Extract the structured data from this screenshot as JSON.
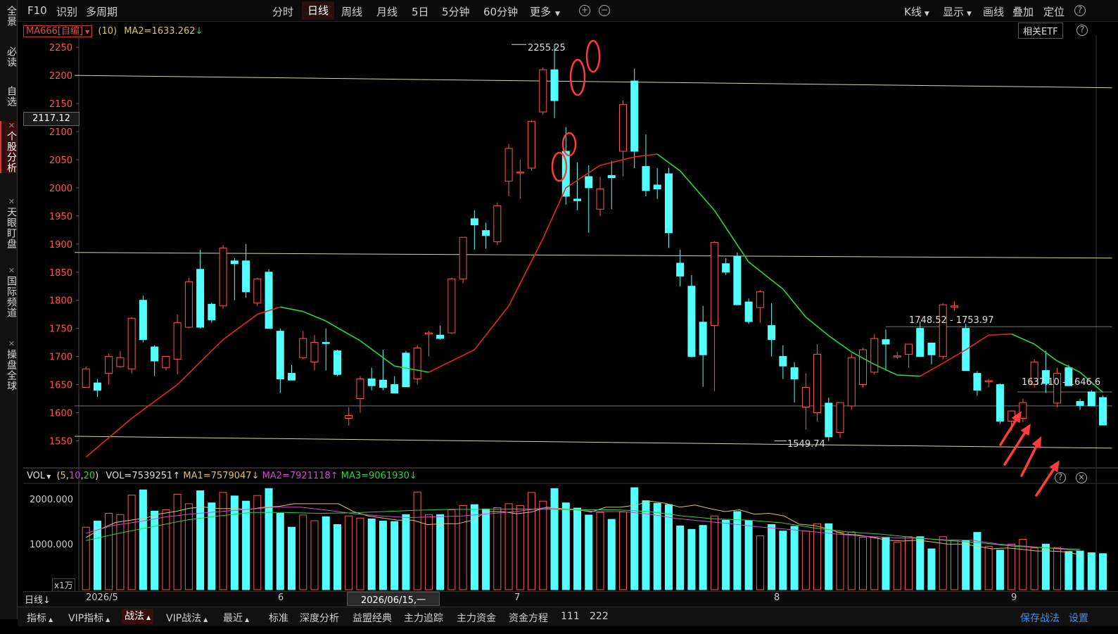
{
  "sidebar": {
    "tabs": [
      {
        "label": "全景",
        "closable": false,
        "active": false
      },
      {
        "label": "必读",
        "closable": false,
        "active": false
      },
      {
        "label": "自选",
        "closable": false,
        "active": false
      },
      {
        "label": "个股分析",
        "closable": true,
        "active": true
      },
      {
        "label": "天眼盯盘",
        "closable": true,
        "active": false
      },
      {
        "label": "国际频道",
        "closable": true,
        "active": false
      },
      {
        "label": "操盘全球",
        "closable": true,
        "active": false
      }
    ],
    "close_glyph": "✕"
  },
  "topbar": {
    "left": [
      "F10",
      "识别",
      "多周期"
    ],
    "periods": [
      "分时",
      "日线",
      "周线",
      "月线",
      "5日",
      "5分钟",
      "60分钟",
      "更多"
    ],
    "active_period": "日线",
    "zoom_in": "+",
    "zoom_out": "−",
    "right": [
      "K线",
      "显示",
      "画线",
      "叠加",
      "定位"
    ],
    "help": "?"
  },
  "indicator_line": {
    "ma_name": "MA666[自编]",
    "param": "(10)",
    "ma2_label": "MA2=1633.262",
    "ma2_arrow": "↓"
  },
  "related_etf": "相关ETF",
  "price_tag": "2117.12",
  "vol_legend": {
    "name": "VOL",
    "params_prefix": "(",
    "p1": "5",
    "p2": "10",
    "p3": "20",
    "params_suffix": ")",
    "vol": "VOL=7539251↑",
    "ma1": "MA1=7579047↓",
    "ma2": "MA2=7921118↑",
    "ma3": "MA3=9061930↓"
  },
  "vol_axis": {
    "ticks": [
      "2000.000",
      "1000.000"
    ],
    "unit": "x1万"
  },
  "datebar": {
    "period_selector": "日线",
    "labels": [
      {
        "text": "2026/5"
      },
      {
        "text": "6"
      },
      {
        "text": "7"
      },
      {
        "text": "8"
      },
      {
        "text": "9"
      }
    ],
    "cursor_date": "2026/06/15,一"
  },
  "bottombar": {
    "menus": [
      "指标",
      "VIP指标",
      "战法",
      "VIP战法",
      "最近"
    ],
    "active_menu": "战法",
    "items": [
      "标准",
      "深度分析",
      "益盟经典",
      "主力追踪",
      "主力资金",
      "资金方程",
      "111",
      "222"
    ],
    "right": [
      "保存战法",
      "设置"
    ]
  },
  "colors": {
    "up": "#ff5555",
    "down": "#54ffff",
    "ma_up": "#e8261f",
    "ma_down": "#27d63a",
    "vma1": "#d9c46a",
    "vma2": "#d44ad4",
    "vma3": "#27d63a",
    "trendline": "#d7d7a0",
    "annotation": "#ff3b3b"
  },
  "chart_data": {
    "type": "candlestick",
    "y_ticks": [
      2250,
      2200,
      2150,
      2100,
      2050,
      2000,
      1950,
      1900,
      1850,
      1800,
      1750,
      1700,
      1650,
      1600,
      1550
    ],
    "ylim": [
      1503,
      2264
    ],
    "annotations": [
      "2255.25",
      "1549.74",
      "1748.52 - 1753.97",
      "1637.10 - 1646.6"
    ],
    "candles": [
      {
        "o": 1645,
        "h": 1682,
        "l": 1648,
        "c": 1678
      },
      {
        "o": 1653,
        "h": 1660,
        "l": 1628,
        "c": 1640
      },
      {
        "o": 1670,
        "h": 1705,
        "l": 1650,
        "c": 1700
      },
      {
        "o": 1682,
        "h": 1710,
        "l": 1680,
        "c": 1698
      },
      {
        "o": 1678,
        "h": 1770,
        "l": 1670,
        "c": 1768
      },
      {
        "o": 1800,
        "h": 1808,
        "l": 1725,
        "c": 1730
      },
      {
        "o": 1717,
        "h": 1720,
        "l": 1665,
        "c": 1692
      },
      {
        "o": 1680,
        "h": 1700,
        "l": 1675,
        "c": 1700
      },
      {
        "o": 1695,
        "h": 1775,
        "l": 1668,
        "c": 1760
      },
      {
        "o": 1752,
        "h": 1840,
        "l": 1750,
        "c": 1833
      },
      {
        "o": 1855,
        "h": 1890,
        "l": 1750,
        "c": 1752
      },
      {
        "o": 1793,
        "h": 1796,
        "l": 1760,
        "c": 1765
      },
      {
        "o": 1790,
        "h": 1898,
        "l": 1785,
        "c": 1893
      },
      {
        "o": 1870,
        "h": 1875,
        "l": 1800,
        "c": 1865
      },
      {
        "o": 1870,
        "h": 1900,
        "l": 1805,
        "c": 1815
      },
      {
        "o": 1795,
        "h": 1840,
        "l": 1790,
        "c": 1838
      },
      {
        "o": 1850,
        "h": 1855,
        "l": 1760,
        "c": 1750
      },
      {
        "o": 1745,
        "h": 1750,
        "l": 1635,
        "c": 1660
      },
      {
        "o": 1670,
        "h": 1685,
        "l": 1658,
        "c": 1658
      },
      {
        "o": 1698,
        "h": 1745,
        "l": 1695,
        "c": 1732
      },
      {
        "o": 1690,
        "h": 1738,
        "l": 1675,
        "c": 1725
      },
      {
        "o": 1725,
        "h": 1750,
        "l": 1675,
        "c": 1723
      },
      {
        "o": 1710,
        "h": 1712,
        "l": 1665,
        "c": 1668
      },
      {
        "o": 1590,
        "h": 1610,
        "l": 1577,
        "c": 1595
      },
      {
        "o": 1625,
        "h": 1665,
        "l": 1600,
        "c": 1660
      },
      {
        "o": 1660,
        "h": 1680,
        "l": 1640,
        "c": 1648
      },
      {
        "o": 1658,
        "h": 1712,
        "l": 1640,
        "c": 1645
      },
      {
        "o": 1650,
        "h": 1665,
        "l": 1637,
        "c": 1635
      },
      {
        "o": 1706,
        "h": 1710,
        "l": 1646,
        "c": 1646
      },
      {
        "o": 1660,
        "h": 1720,
        "l": 1650,
        "c": 1715
      },
      {
        "o": 1740,
        "h": 1745,
        "l": 1700,
        "c": 1742
      },
      {
        "o": 1738,
        "h": 1755,
        "l": 1730,
        "c": 1732
      },
      {
        "o": 1742,
        "h": 1840,
        "l": 1740,
        "c": 1838
      },
      {
        "o": 1838,
        "h": 1890,
        "l": 1830,
        "c": 1912
      },
      {
        "o": 1945,
        "h": 1960,
        "l": 1890,
        "c": 1934
      },
      {
        "o": 1924,
        "h": 1938,
        "l": 1892,
        "c": 1915
      },
      {
        "o": 1904,
        "h": 1974,
        "l": 1898,
        "c": 1968
      },
      {
        "o": 2012,
        "h": 2078,
        "l": 1985,
        "c": 2070
      },
      {
        "o": 2028,
        "h": 2050,
        "l": 1980,
        "c": 2028
      },
      {
        "o": 2035,
        "h": 2120,
        "l": 2030,
        "c": 2118
      },
      {
        "o": 2135,
        "h": 2214,
        "l": 2130,
        "c": 2210
      },
      {
        "o": 2210,
        "h": 2255,
        "l": 2124,
        "c": 2155
      },
      {
        "o": 2065,
        "h": 2108,
        "l": 1970,
        "c": 1985
      },
      {
        "o": 1980,
        "h": 2045,
        "l": 1960,
        "c": 1977
      },
      {
        "o": 2020,
        "h": 2040,
        "l": 1920,
        "c": 2000
      },
      {
        "o": 1962,
        "h": 2020,
        "l": 1950,
        "c": 1998
      },
      {
        "o": 2022,
        "h": 2048,
        "l": 1962,
        "c": 2018
      },
      {
        "o": 2065,
        "h": 2155,
        "l": 2020,
        "c": 2148
      },
      {
        "o": 2190,
        "h": 2212,
        "l": 2035,
        "c": 2065
      },
      {
        "o": 2038,
        "h": 2095,
        "l": 1985,
        "c": 1995
      },
      {
        "o": 2005,
        "h": 2035,
        "l": 1980,
        "c": 1998
      },
      {
        "o": 2025,
        "h": 2035,
        "l": 1893,
        "c": 1920
      },
      {
        "o": 1866,
        "h": 1890,
        "l": 1825,
        "c": 1843
      },
      {
        "o": 1825,
        "h": 1845,
        "l": 1698,
        "c": 1700
      },
      {
        "o": 1761,
        "h": 1790,
        "l": 1646,
        "c": 1703
      },
      {
        "o": 1755,
        "h": 1905,
        "l": 1638,
        "c": 1903
      },
      {
        "o": 1865,
        "h": 1875,
        "l": 1845,
        "c": 1850
      },
      {
        "o": 1878,
        "h": 1885,
        "l": 1825,
        "c": 1792
      },
      {
        "o": 1797,
        "h": 1803,
        "l": 1758,
        "c": 1762
      },
      {
        "o": 1787,
        "h": 1818,
        "l": 1760,
        "c": 1815
      },
      {
        "o": 1755,
        "h": 1795,
        "l": 1700,
        "c": 1730
      },
      {
        "o": 1700,
        "h": 1720,
        "l": 1660,
        "c": 1683
      },
      {
        "o": 1680,
        "h": 1690,
        "l": 1618,
        "c": 1660
      },
      {
        "o": 1610,
        "h": 1670,
        "l": 1570,
        "c": 1645
      },
      {
        "o": 1600,
        "h": 1722,
        "l": 1584,
        "c": 1704
      },
      {
        "o": 1617,
        "h": 1627,
        "l": 1549,
        "c": 1557
      },
      {
        "o": 1565,
        "h": 1618,
        "l": 1555,
        "c": 1618
      },
      {
        "o": 1612,
        "h": 1705,
        "l": 1605,
        "c": 1698
      },
      {
        "o": 1650,
        "h": 1715,
        "l": 1645,
        "c": 1712
      },
      {
        "o": 1672,
        "h": 1740,
        "l": 1668,
        "c": 1732
      },
      {
        "o": 1730,
        "h": 1748,
        "l": 1675,
        "c": 1722
      },
      {
        "o": 1701,
        "h": 1708,
        "l": 1696,
        "c": 1701
      },
      {
        "o": 1704,
        "h": 1720,
        "l": 1680,
        "c": 1722
      },
      {
        "o": 1750,
        "h": 1762,
        "l": 1700,
        "c": 1700
      },
      {
        "o": 1724,
        "h": 1725,
        "l": 1686,
        "c": 1703
      },
      {
        "o": 1700,
        "h": 1795,
        "l": 1695,
        "c": 1792
      },
      {
        "o": 1788,
        "h": 1798,
        "l": 1782,
        "c": 1790
      },
      {
        "o": 1750,
        "h": 1758,
        "l": 1680,
        "c": 1675
      },
      {
        "o": 1670,
        "h": 1674,
        "l": 1630,
        "c": 1640
      },
      {
        "o": 1655,
        "h": 1660,
        "l": 1645,
        "c": 1657
      },
      {
        "o": 1650,
        "h": 1652,
        "l": 1580,
        "c": 1585
      },
      {
        "o": 1585,
        "h": 1604,
        "l": 1568,
        "c": 1603
      },
      {
        "o": 1590,
        "h": 1625,
        "l": 1583,
        "c": 1618
      },
      {
        "o": 1650,
        "h": 1695,
        "l": 1645,
        "c": 1690
      },
      {
        "o": 1675,
        "h": 1710,
        "l": 1635,
        "c": 1652
      },
      {
        "o": 1617,
        "h": 1680,
        "l": 1610,
        "c": 1670
      },
      {
        "o": 1680,
        "h": 1685,
        "l": 1650,
        "c": 1648
      },
      {
        "o": 1620,
        "h": 1625,
        "l": 1605,
        "c": 1613
      },
      {
        "o": 1637,
        "h": 1640,
        "l": 1615,
        "c": 1612
      },
      {
        "o": 1627,
        "h": 1631,
        "l": 1578,
        "c": 1578
      }
    ],
    "ma": [
      {
        "i": 0,
        "v": 1521
      },
      {
        "i": 4,
        "v": 1590
      },
      {
        "i": 8,
        "v": 1650
      },
      {
        "i": 12,
        "v": 1730
      },
      {
        "i": 15,
        "v": 1775
      },
      {
        "i": 17,
        "v": 1788
      },
      {
        "i": 19,
        "v": 1780
      },
      {
        "i": 21,
        "v": 1763
      },
      {
        "i": 24,
        "v": 1728
      },
      {
        "i": 27,
        "v": 1683
      },
      {
        "i": 30,
        "v": 1672
      },
      {
        "i": 34,
        "v": 1712
      },
      {
        "i": 37,
        "v": 1790
      },
      {
        "i": 40,
        "v": 1910
      },
      {
        "i": 42,
        "v": 2000
      },
      {
        "i": 45,
        "v": 2040
      },
      {
        "i": 48,
        "v": 2055
      },
      {
        "i": 50,
        "v": 2060
      },
      {
        "i": 52,
        "v": 2030
      },
      {
        "i": 55,
        "v": 1960
      },
      {
        "i": 58,
        "v": 1868
      },
      {
        "i": 61,
        "v": 1820
      },
      {
        "i": 63,
        "v": 1770
      },
      {
        "i": 65,
        "v": 1737
      },
      {
        "i": 67,
        "v": 1708
      },
      {
        "i": 69,
        "v": 1686
      },
      {
        "i": 71,
        "v": 1667
      },
      {
        "i": 73,
        "v": 1665
      },
      {
        "i": 75,
        "v": 1688
      },
      {
        "i": 77,
        "v": 1712
      },
      {
        "i": 79,
        "v": 1738
      },
      {
        "i": 81,
        "v": 1740
      },
      {
        "i": 83,
        "v": 1722
      },
      {
        "i": 85,
        "v": 1692
      },
      {
        "i": 87,
        "v": 1672
      },
      {
        "i": 88,
        "v": 1654
      },
      {
        "i": 89,
        "v": 1636
      }
    ],
    "trendlines": [
      {
        "x1": -1.0,
        "y1": 2200,
        "x2": 89.8,
        "y2": 2178
      },
      {
        "x1": -1.0,
        "y1": 1885,
        "x2": 89.8,
        "y2": 1875
      },
      {
        "x1": -1.0,
        "y1": 1558,
        "x2": 89.8,
        "y2": 1537
      }
    ],
    "hlines": [
      {
        "x1": 70,
        "y": 1753,
        "x2": 89.8
      },
      {
        "x1": 81.5,
        "y": 1637,
        "x2": 89.8
      },
      {
        "x1": -1.0,
        "y": 1612,
        "x2": 89.8
      }
    ],
    "volumes": [
      1440,
      1580,
      1760,
      1730,
      2180,
      2300,
      1810,
      1840,
      2200,
      1980,
      2280,
      2000,
      2240,
      2160,
      2040,
      2170,
      2330,
      1760,
      1440,
      1720,
      1590,
      1680,
      1500,
      1700,
      1650,
      1630,
      1580,
      1570,
      1730,
      2250,
      1730,
      1730,
      1840,
      1940,
      1960,
      1860,
      1890,
      1980,
      1940,
      2240,
      2040,
      2330,
      2000,
      1880,
      1720,
      1780,
      1620,
      1790,
      2350,
      2050,
      1990,
      1960,
      1470,
      1390,
      1480,
      1700,
      1600,
      1800,
      1590,
      1240,
      1500,
      1350,
      1460,
      1350,
      1520,
      1520,
      1320,
      1330,
      1210,
      1210,
      1210,
      1090,
      1220,
      1220,
      940,
      1220,
      1140,
      1130,
      1320,
      1000,
      910,
      1050,
      1160,
      960,
      1050,
      970,
      880,
      890,
      850,
      830
    ],
    "vol_ma": {
      "ma1": [
        1200,
        1400,
        1550,
        1600,
        1650,
        1750,
        1800,
        1880,
        1900,
        1870,
        1870,
        1850,
        1900,
        1920,
        1980,
        1980,
        1980,
        1980,
        1800,
        1700,
        1650,
        1600,
        1600,
        1500,
        1520,
        1520,
        1600,
        1800,
        1800,
        1750,
        1790,
        1900,
        1870,
        1850,
        1790,
        1900,
        1900,
        1950,
        2040,
        1990,
        1900,
        1950,
        1870,
        1800,
        1840,
        1740,
        1760,
        1700,
        1510,
        1480,
        1400,
        1280,
        1260,
        1200,
        1140,
        1120,
        1140,
        1100,
        1050,
        1050,
        1000,
        940,
        960,
        930,
        890,
        890,
        870,
        800
      ],
      "ma2": [
        1300,
        1480,
        1570,
        1680,
        1750,
        1800,
        1850,
        1900,
        1900,
        1830,
        1750,
        1700,
        1660,
        1680,
        1700,
        1750,
        1800,
        1880,
        1850,
        1800,
        1800,
        1740,
        1640,
        1580,
        1520,
        1450,
        1400,
        1340,
        1280,
        1230,
        1200,
        1180,
        1150,
        1140,
        1050,
        1000,
        950,
        900
      ],
      "ma3": [
        1130,
        1300,
        1450,
        1600,
        1700,
        1780,
        1780,
        1760,
        1770,
        1800,
        1830,
        1850,
        1850,
        1860,
        1850,
        1840,
        1840,
        1800,
        1700,
        1630,
        1600,
        1540,
        1420,
        1330,
        1280,
        1200,
        1130,
        1080,
        1000,
        960,
        930
      ]
    }
  },
  "arrows": [
    {
      "from": [
        1,
        2
      ],
      "to": [
        3,
        4
      ]
    }
  ]
}
